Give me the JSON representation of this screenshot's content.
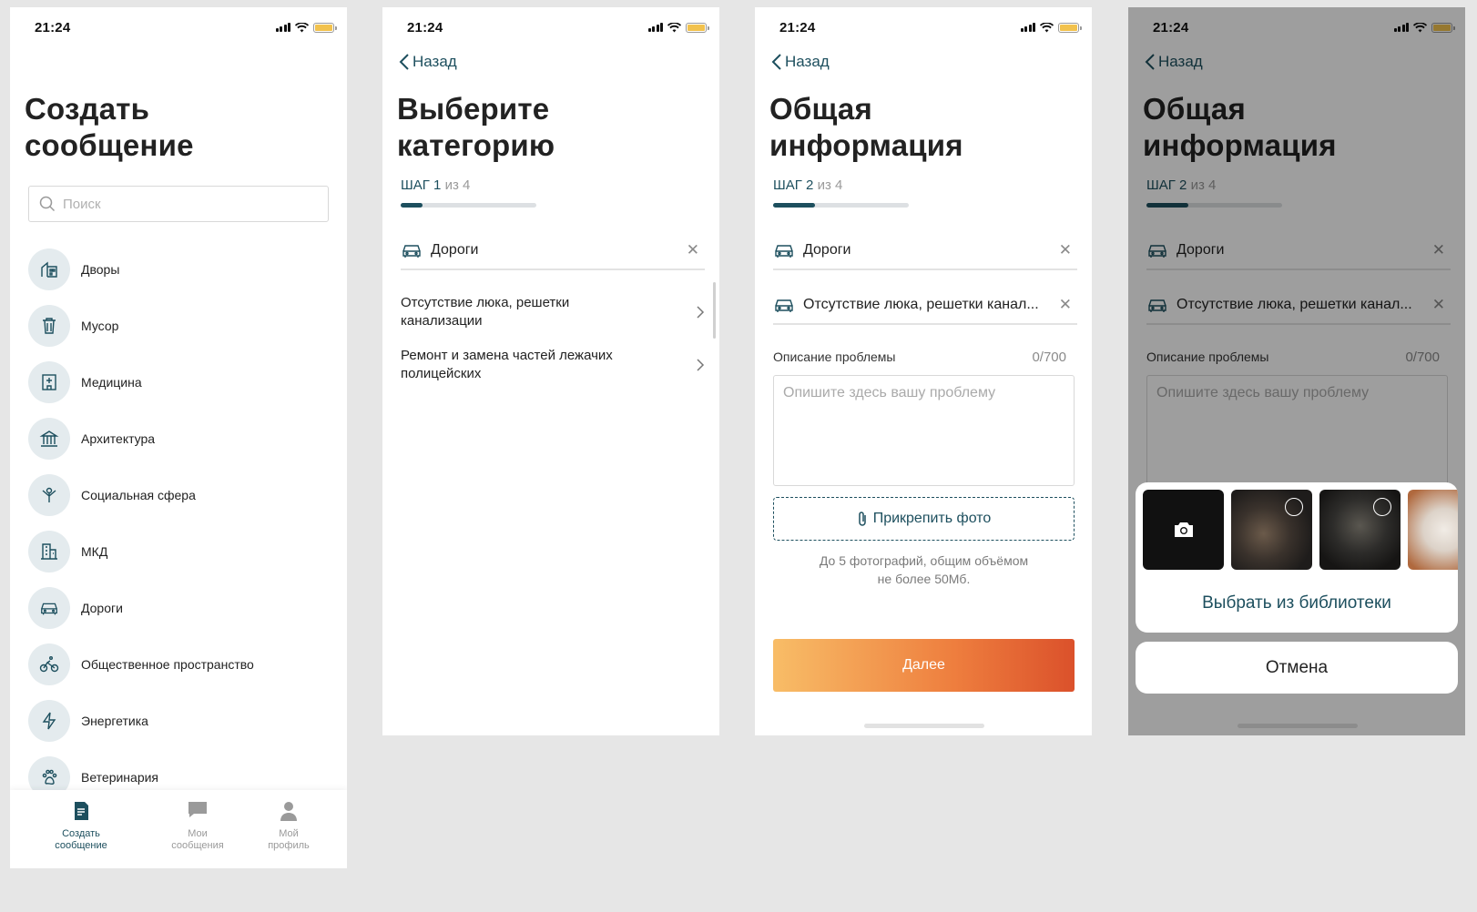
{
  "status": {
    "time": "21:24"
  },
  "screen1": {
    "title_line1": "Создать",
    "title_line2": "сообщение",
    "search_placeholder": "Поиск",
    "categories": [
      {
        "label": "Дворы",
        "icon": "yard-icon"
      },
      {
        "label": "Мусор",
        "icon": "trash-icon"
      },
      {
        "label": "Медицина",
        "icon": "hospital-icon"
      },
      {
        "label": "Архитектура",
        "icon": "architecture-icon"
      },
      {
        "label": "Социальная сфера",
        "icon": "social-icon"
      },
      {
        "label": "МКД",
        "icon": "building-icon"
      },
      {
        "label": "Дороги",
        "icon": "car-icon"
      },
      {
        "label": "Общественное пространство",
        "icon": "bicycle-icon"
      },
      {
        "label": "Энергетика",
        "icon": "lightning-icon"
      },
      {
        "label": "Ветеринария",
        "icon": "paw-icon"
      }
    ],
    "tabs": [
      {
        "line1": "Создать",
        "line2": "сообщение",
        "icon": "document-icon",
        "active": true
      },
      {
        "line1": "Мои",
        "line2": "сообщения",
        "icon": "chat-icon",
        "active": false
      },
      {
        "line1": "Мой",
        "line2": "профиль",
        "icon": "profile-icon",
        "active": false
      }
    ]
  },
  "screen2": {
    "back": "Назад",
    "title_line1": "Выберите",
    "title_line2": "категорию",
    "step_label": "ШАГ 1",
    "step_of": "из 4",
    "step_progress": 0.16,
    "selected": "Дороги",
    "items": [
      {
        "label": "Отсутствие люка, решетки канализации"
      },
      {
        "label": "Ремонт и замена частей лежачих полицейских"
      }
    ]
  },
  "screen3": {
    "back": "Назад",
    "title_line1": "Общая",
    "title_line2": "информация",
    "step_label": "ШАГ 2",
    "step_of": "из 4",
    "step_progress": 0.31,
    "selected1": "Дороги",
    "selected2": "Отсутствие люка, решетки канал...",
    "desc_label": "Описание проблемы",
    "desc_count": "0/700",
    "desc_placeholder": "Опишите здесь вашу проблему",
    "attach": "Прикрепить фото",
    "hint_line1": "До 5 фотографий, общим объёмом",
    "hint_line2": "не более 50Мб.",
    "next": "Далее"
  },
  "screen4": {
    "choose_library": "Выбрать из библиотеки",
    "cancel": "Отмена"
  },
  "colors": {
    "accent": "#1d4f5e",
    "gradient_start": "#f8bd67",
    "gradient_end": "#db512b"
  }
}
